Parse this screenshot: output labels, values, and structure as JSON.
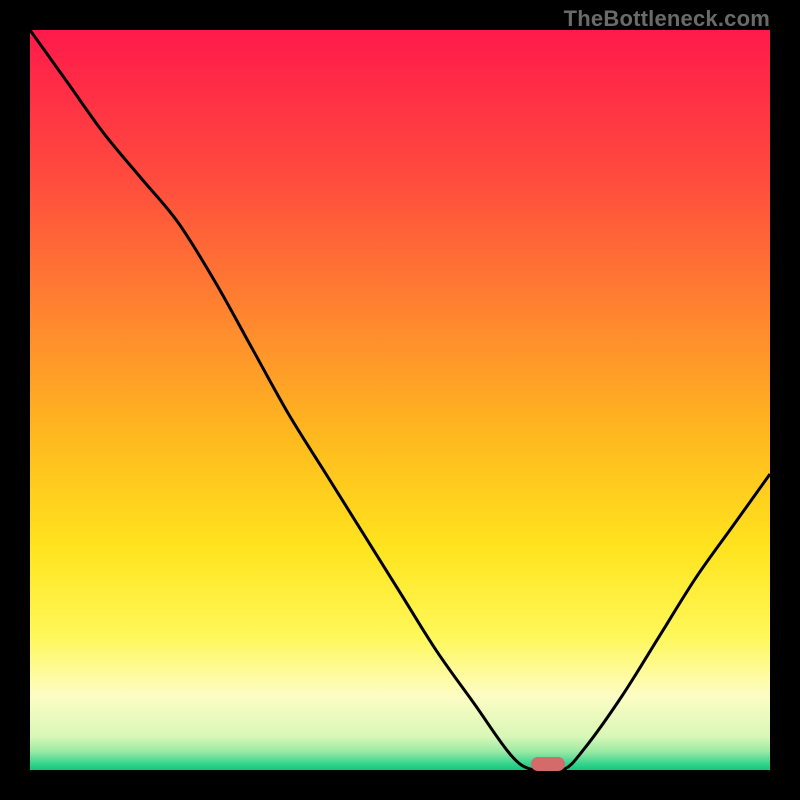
{
  "watermark": "TheBottleneck.com",
  "colors": {
    "curve": "#000000",
    "marker": "#d46a6a",
    "gradient": [
      {
        "pos": 0.0,
        "color": "#ff1a4b"
      },
      {
        "pos": 0.2,
        "color": "#ff4b3e"
      },
      {
        "pos": 0.4,
        "color": "#ff8a2e"
      },
      {
        "pos": 0.55,
        "color": "#ffb91e"
      },
      {
        "pos": 0.7,
        "color": "#ffe41e"
      },
      {
        "pos": 0.82,
        "color": "#fff85a"
      },
      {
        "pos": 0.9,
        "color": "#fdfdc4"
      },
      {
        "pos": 0.955,
        "color": "#d8f7b7"
      },
      {
        "pos": 0.975,
        "color": "#9be9a4"
      },
      {
        "pos": 0.99,
        "color": "#3ed690"
      },
      {
        "pos": 1.0,
        "color": "#11c77c"
      }
    ]
  },
  "chart_data": {
    "type": "line",
    "title": "",
    "xlabel": "",
    "ylabel": "",
    "xlim": [
      0,
      100
    ],
    "ylim": [
      0,
      100
    ],
    "x": [
      0,
      5,
      10,
      15,
      20,
      25,
      30,
      35,
      40,
      45,
      50,
      55,
      60,
      65,
      68,
      72,
      75,
      80,
      85,
      90,
      95,
      100
    ],
    "values": [
      100,
      93,
      86,
      80,
      74,
      66,
      57,
      48,
      40,
      32,
      24,
      16,
      9,
      2,
      0,
      0,
      3,
      10,
      18,
      26,
      33,
      40
    ],
    "marker": {
      "x": 70,
      "y": 0.8
    }
  }
}
